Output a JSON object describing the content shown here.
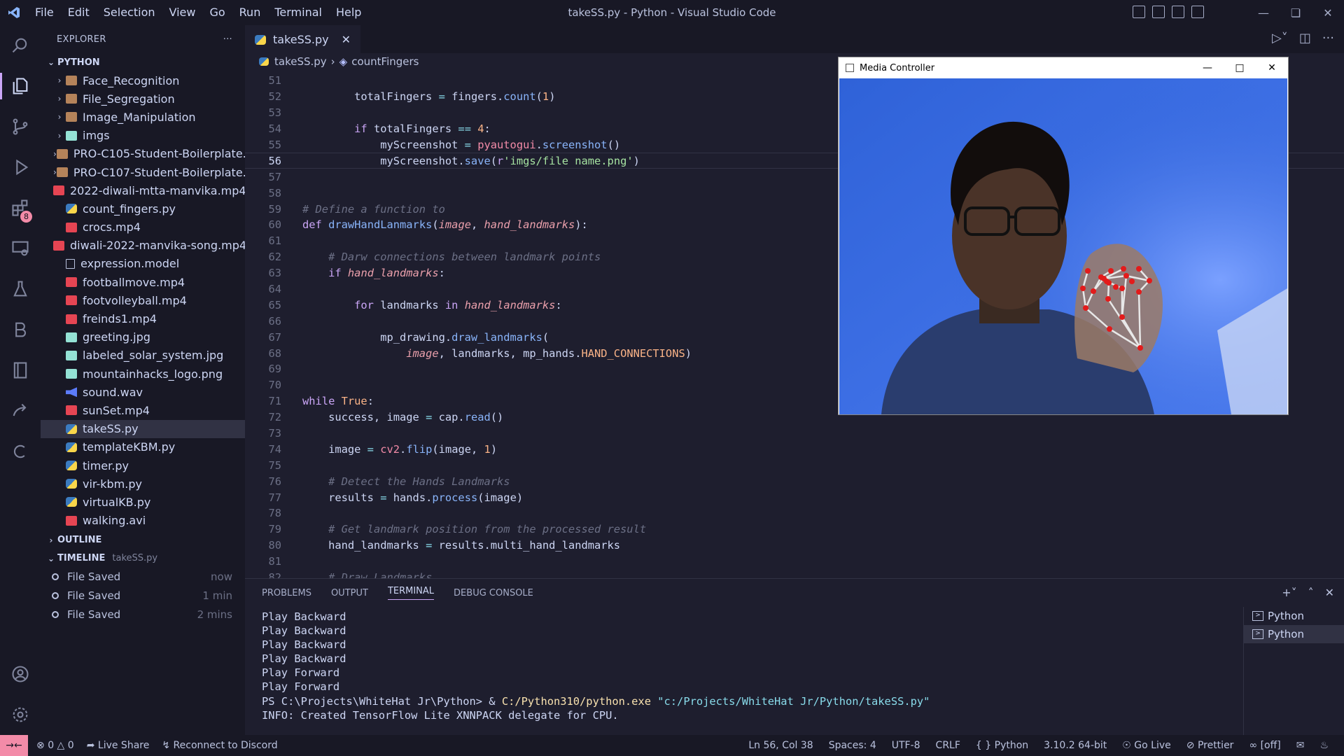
{
  "window": {
    "title": "takeSS.py - Python - Visual Studio Code"
  },
  "menu": [
    "File",
    "Edit",
    "Selection",
    "View",
    "Go",
    "Run",
    "Terminal",
    "Help"
  ],
  "activity": {
    "extensions_badge": "8"
  },
  "explorer": {
    "header": "EXPLORER",
    "root": "PYTHON",
    "items": [
      {
        "name": "Face_Recognition",
        "type": "folder"
      },
      {
        "name": "File_Segregation",
        "type": "folder"
      },
      {
        "name": "Image_Manipulation",
        "type": "folder"
      },
      {
        "name": "imgs",
        "type": "imgfolder"
      },
      {
        "name": "PRO-C105-Student-Boilerplate...",
        "type": "folder"
      },
      {
        "name": "PRO-C107-Student-Boilerplate...",
        "type": "folder"
      },
      {
        "name": "2022-diwali-mtta-manvika.mp4",
        "type": "mp4"
      },
      {
        "name": "count_fingers.py",
        "type": "py"
      },
      {
        "name": "crocs.mp4",
        "type": "mp4"
      },
      {
        "name": "diwali-2022-manvika-song.mp4",
        "type": "mp4"
      },
      {
        "name": "expression.model",
        "type": "txt"
      },
      {
        "name": "footballmove.mp4",
        "type": "mp4"
      },
      {
        "name": "footvolleyball.mp4",
        "type": "mp4"
      },
      {
        "name": "freinds1.mp4",
        "type": "mp4"
      },
      {
        "name": "greeting.jpg",
        "type": "img"
      },
      {
        "name": "labeled_solar_system.jpg",
        "type": "img"
      },
      {
        "name": "mountainhacks_logo.png",
        "type": "img"
      },
      {
        "name": "sound.wav",
        "type": "wav"
      },
      {
        "name": "sunSet.mp4",
        "type": "mp4"
      },
      {
        "name": "takeSS.py",
        "type": "py",
        "selected": true
      },
      {
        "name": "templateKBM.py",
        "type": "py"
      },
      {
        "name": "timer.py",
        "type": "py"
      },
      {
        "name": "vir-kbm.py",
        "type": "py"
      },
      {
        "name": "virtualKB.py",
        "type": "py"
      },
      {
        "name": "walking.avi",
        "type": "mp4"
      }
    ],
    "outline": "OUTLINE",
    "timeline": {
      "label": "TIMELINE",
      "file": "takeSS.py",
      "entries": [
        {
          "label": "File Saved",
          "when": "now"
        },
        {
          "label": "File Saved",
          "when": "1 min"
        },
        {
          "label": "File Saved",
          "when": "2 mins"
        }
      ]
    }
  },
  "editor": {
    "tab": "takeSS.py",
    "breadcrumb": {
      "file": "takeSS.py",
      "symbol": "countFingers"
    },
    "current_line": 56,
    "lines": [
      {
        "n": "51",
        "html": ""
      },
      {
        "n": "52",
        "html": "        totalFingers <span class='op'>=</span> fingers.<span class='fn'>count</span>(<span class='num'>1</span>)"
      },
      {
        "n": "53",
        "html": ""
      },
      {
        "n": "54",
        "html": "        <span class='kw'>if</span> totalFingers <span class='op'>==</span> <span class='num'>4</span>:"
      },
      {
        "n": "55",
        "html": "            myScreenshot <span class='op'>=</span> <span class='bi'>pyautogui</span>.<span class='fn'>screenshot</span>()"
      },
      {
        "n": "56",
        "html": "            myScreenshot.<span class='fn'>save</span>(<span class='kw'>r</span><span class='str'>'imgs/file name.png'</span>)"
      },
      {
        "n": "57",
        "html": ""
      },
      {
        "n": "58",
        "html": ""
      },
      {
        "n": "59",
        "html": "<span class='cm'># Define a function to</span>"
      },
      {
        "n": "60",
        "html": "<span class='kw'>def</span> <span class='fn'>drawHandLanmarks</span>(<span class='pm'>image</span>, <span class='pm'>hand_landmarks</span>):"
      },
      {
        "n": "61",
        "html": ""
      },
      {
        "n": "62",
        "html": "    <span class='cm'># Darw connections between landmark points</span>"
      },
      {
        "n": "63",
        "html": "    <span class='kw'>if</span> <span class='pm'>hand_landmarks</span>:"
      },
      {
        "n": "64",
        "html": ""
      },
      {
        "n": "65",
        "html": "        <span class='kw'>for</span> landmarks <span class='kw'>in</span> <span class='pm'>hand_landmarks</span>:"
      },
      {
        "n": "66",
        "html": ""
      },
      {
        "n": "67",
        "html": "            mp_drawing.<span class='fn'>draw_landmarks</span>("
      },
      {
        "n": "68",
        "html": "                <span class='pm'>image</span>, landmarks, mp_hands.<span class='cst'>HAND_CONNECTIONS</span>)"
      },
      {
        "n": "69",
        "html": ""
      },
      {
        "n": "70",
        "html": ""
      },
      {
        "n": "71",
        "html": "<span class='kw'>while</span> <span class='cst'>True</span>:"
      },
      {
        "n": "72",
        "html": "    success, image <span class='op'>=</span> cap.<span class='fn'>read</span>()"
      },
      {
        "n": "73",
        "html": ""
      },
      {
        "n": "74",
        "html": "    image <span class='op'>=</span> <span class='bi'>cv2</span>.<span class='fn'>flip</span>(image, <span class='num'>1</span>)"
      },
      {
        "n": "75",
        "html": ""
      },
      {
        "n": "76",
        "html": "    <span class='cm'># Detect the Hands Landmarks</span>"
      },
      {
        "n": "77",
        "html": "    results <span class='op'>=</span> hands.<span class='fn'>process</span>(image)"
      },
      {
        "n": "78",
        "html": ""
      },
      {
        "n": "79",
        "html": "    <span class='cm'># Get landmark position from the processed result</span>"
      },
      {
        "n": "80",
        "html": "    hand_landmarks <span class='op'>=</span> results.multi_hand_landmarks"
      },
      {
        "n": "81",
        "html": ""
      },
      {
        "n": "82",
        "html": "    <span class='cm'># Draw Landmarks</span>"
      }
    ]
  },
  "panel": {
    "tabs": [
      "PROBLEMS",
      "OUTPUT",
      "TERMINAL",
      "DEBUG CONSOLE"
    ],
    "active": "TERMINAL",
    "terminal_lines": [
      "Play Backward",
      "Play Backward",
      "Play Backward",
      "Play Backward",
      "Play Forward",
      "Play Forward",
      "PS C:\\Projects\\WhiteHat Jr\\Python> & C:/Python310/python.exe \"c:/Projects/WhiteHat Jr/Python/takeSS.py\"",
      "INFO: Created TensorFlow Lite XNNPACK delegate for CPU."
    ],
    "terminals": [
      "Python",
      "Python"
    ]
  },
  "media_window": {
    "title": "Media Controller"
  },
  "status": {
    "errors": "0",
    "warnings": "0",
    "live_share": "Live Share",
    "discord": "Reconnect to Discord",
    "position": "Ln 56, Col 38",
    "spaces": "Spaces: 4",
    "encoding": "UTF-8",
    "eol": "CRLF",
    "language": "Python",
    "interpreter": "3.10.2 64-bit",
    "go_live": "Go Live",
    "prettier": "Prettier",
    "off": "[off]"
  },
  "colors": {
    "accent": "#cba6f7",
    "badge": "#f38ba8",
    "background": "#1e1e2e",
    "sidebar": "#181825"
  }
}
